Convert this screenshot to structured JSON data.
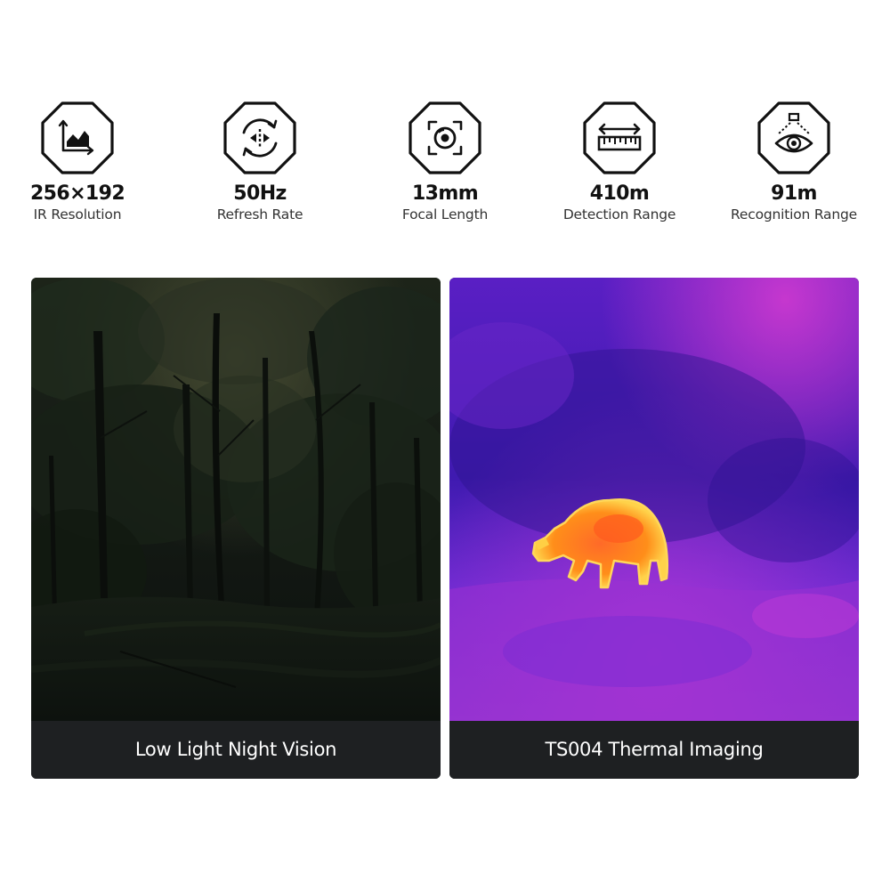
{
  "specs": [
    {
      "icon": "resolution-chart-icon",
      "value": "256×192",
      "label": "IR Resolution"
    },
    {
      "icon": "refresh-rotate-icon",
      "value": "50Hz",
      "label": "Refresh Rate"
    },
    {
      "icon": "focus-lens-icon",
      "value": "13mm",
      "label": "Focal Length"
    },
    {
      "icon": "ruler-distance-icon",
      "value": "410m",
      "label": "Detection Range"
    },
    {
      "icon": "eye-recognition-icon",
      "value": "91m",
      "label": "Recognition Range"
    }
  ],
  "comparison": {
    "left": {
      "caption": "Low Light Night Vision",
      "image": "dark-forest-night-scene"
    },
    "right": {
      "caption": "TS004 Thermal Imaging",
      "image": "thermal-animal-scene"
    }
  },
  "colors": {
    "icon_stroke": "#111111",
    "caption_bg": "#1e2022",
    "thermal_cold": "#3f1fb8",
    "thermal_warm": "#c233d0",
    "thermal_hot": "#ff9a18"
  }
}
